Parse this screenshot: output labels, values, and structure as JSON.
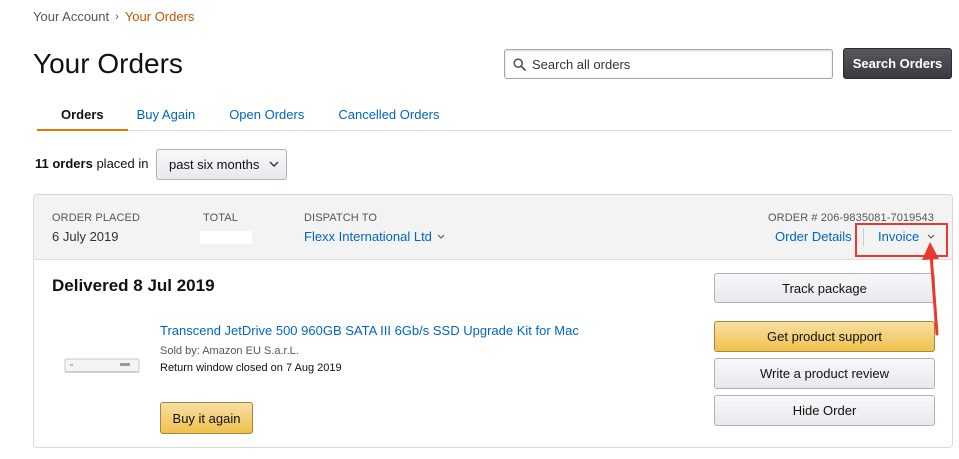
{
  "breadcrumb": {
    "parent": "Your Account",
    "separator": "›",
    "current": "Your Orders"
  },
  "page_title": "Your Orders",
  "search": {
    "placeholder": "Search all orders",
    "button_label": "Search Orders"
  },
  "tabs": [
    {
      "label": "Orders",
      "active": true
    },
    {
      "label": "Buy Again",
      "active": false
    },
    {
      "label": "Open Orders",
      "active": false
    },
    {
      "label": "Cancelled Orders",
      "active": false
    }
  ],
  "summary": {
    "count": "11 orders",
    "suffix": "placed in",
    "period": "past six months"
  },
  "order": {
    "placed_label": "ORDER PLACED",
    "placed_value": "6 July 2019",
    "total_label": "TOTAL",
    "dispatch_label": "DISPATCH TO",
    "dispatch_value": "Flexx International Ltd",
    "order_number": "ORDER # 206-9835081-7019543",
    "details_link": "Order Details",
    "invoice_link": "Invoice",
    "status": "Delivered 8 Jul 2019",
    "product_title": "Transcend JetDrive 500 960GB SATA III 6Gb/s SSD Upgrade Kit for Mac",
    "sold_by": "Sold by: Amazon EU S.a.r.L.",
    "return_window": "Return window closed on 7 Aug 2019",
    "buy_again_label": "Buy it again",
    "actions": {
      "track": "Track package",
      "support": "Get product support",
      "review": "Write a product review",
      "hide": "Hide Order"
    }
  },
  "annotation": {
    "color": "#e8392e"
  },
  "colors": {
    "link": "#0066c0",
    "accent_orange": "#e77600",
    "breadcrumb_current": "#c45500"
  }
}
